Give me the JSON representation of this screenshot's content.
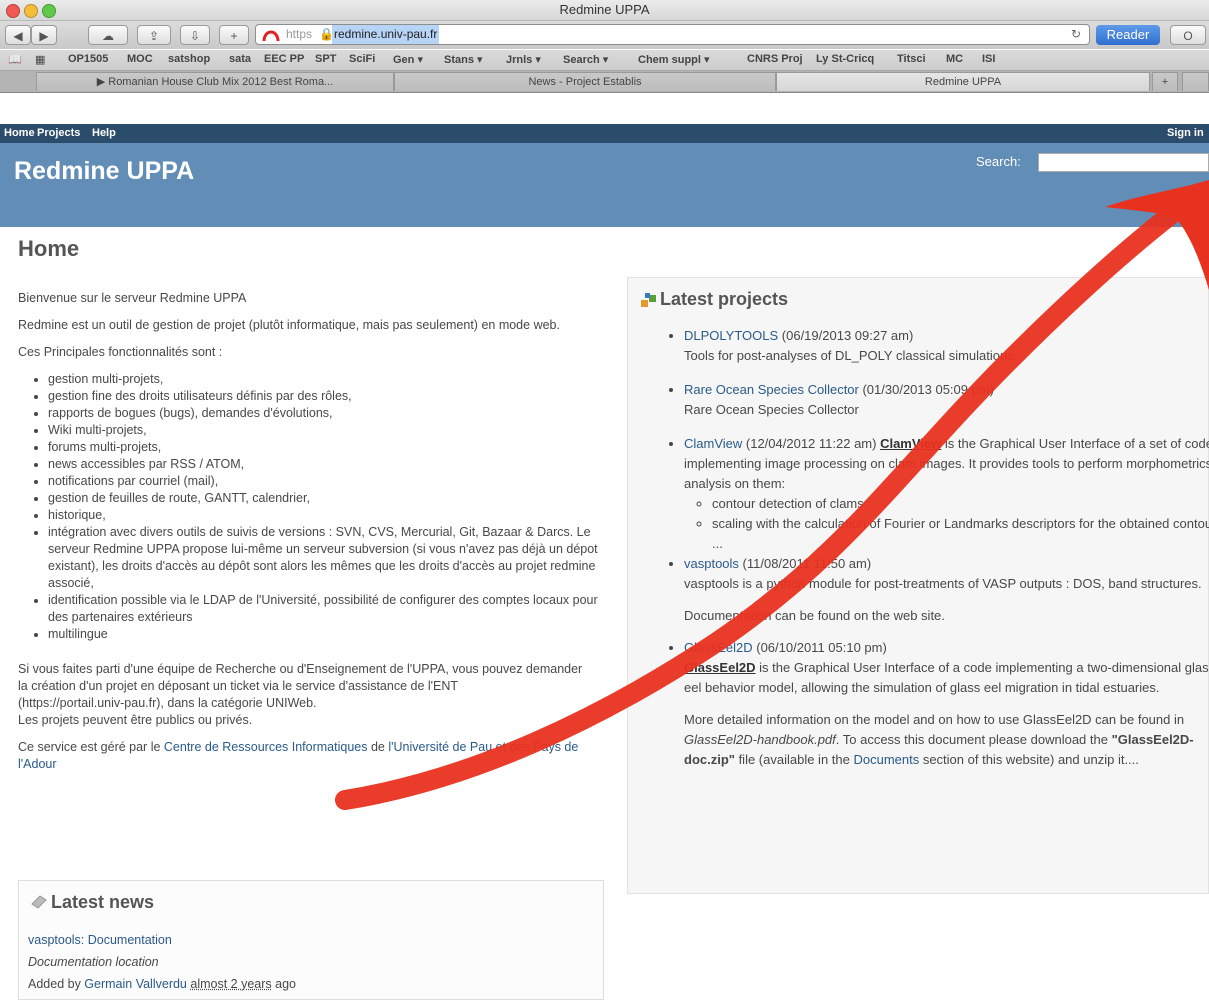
{
  "browser": {
    "window_title": "Redmine UPPA",
    "url_protocol": "https",
    "url_host": "redmine.univ-pau.fr",
    "reader_label": "Reader",
    "bookmarks": [
      "OP1505",
      "MOC",
      "satshop",
      "sata",
      "EEC PP",
      "SPT",
      "SciFi",
      "Gen ▾",
      "Stans ▾",
      "Jrnls ▾",
      "Search ▾",
      "Chem suppl ▾",
      "CNRS Proj",
      "Ly St-Cricq",
      "Titsci",
      "MC",
      "ISI"
    ],
    "tabs": [
      "▶ Romanian House Club Mix 2012 Best Roma...",
      "News - Project Establis",
      "Redmine UPPA"
    ],
    "new_tab_label": "+"
  },
  "topmenu": {
    "home": "Home",
    "projects": "Projects",
    "help": "Help",
    "sign_in": "Sign in"
  },
  "header": {
    "title": "Redmine UPPA",
    "search_label": "Search:"
  },
  "main": {
    "heading": "Home",
    "welcome": "Bienvenue sur le serveur Redmine UPPA",
    "intro": "Redmine est un outil de gestion de projet (plutôt informatique, mais pas seulement) en mode web.",
    "features_title": "Ces Principales fonctionnalités sont :",
    "features": [
      "gestion multi-projets,",
      "gestion fine des droits utilisateurs définis par des rôles,",
      "rapports de bogues (bugs), demandes d'évolutions,",
      "Wiki multi-projets,",
      "forums multi-projets,",
      "news accessibles par RSS / ATOM,",
      "notifications par courriel (mail),",
      "gestion de feuilles de route, GANTT, calendrier,",
      "historique,",
      "intégration avec divers outils de suivis de versions : SVN, CVS, Mercurial, Git, Bazaar & Darcs. Le serveur Redmine UPPA propose lui-même un serveur subversion (si vous n'avez pas déjà un dépot existant), les droits d'accès au dépôt sont alors les mêmes que les droits d'accès au projet redmine associé,",
      "identification possible via le LDAP de l'Université, possibilité de configurer des comptes locaux pour des partenaires extérieurs",
      "multilingue"
    ],
    "request_1": "Si vous faites parti d'une équipe de Recherche ou d'Enseignement de l'UPPA, vous pouvez demander",
    "request_2": "la création d'un projet en déposant un ticket via le service d'assistance de l'ENT",
    "request_3": "(https://portail.univ-pau.fr), dans la catégorie UNIWeb.",
    "request_4": "Les projets peuvent être publics ou privés.",
    "managed_prefix": "Ce service est géré par le ",
    "managed_link1": "Centre de Ressources Informatiques",
    "managed_mid": " de ",
    "managed_link2": "l'Université de Pau et des Pays de l'Adour"
  },
  "news": {
    "heading": "Latest news",
    "item_title": "vasptools: Documentation",
    "item_desc": "Documentation location",
    "added_by": "Added by ",
    "author": "Germain Vallverdu",
    "time": "almost 2 years",
    "ago": " ago"
  },
  "projects": {
    "heading": "Latest projects",
    "items": [
      {
        "name": "DLPOLYTOOLS",
        "date": " (06/19/2013 09:27 am)",
        "desc": "Tools for post-analyses of DL_POLY classical simulations."
      },
      {
        "name": "Rare Ocean Species Collector",
        "date": " (01/30/2013 05:09 pm)",
        "desc": "Rare Ocean Species Collector"
      },
      {
        "name": "ClamView",
        "date": " (12/04/2012 11:22 am) ",
        "bold": "ClamView",
        "desc": " is the Graphical User Interface of a set of codes implementing image processing on clam images. It provides tools to perform morphometrics analysis on them:",
        "sub": [
          "contour detection of clams;",
          "scaling with the calculation of Fourier or Landmarks descriptors for the obtained contours; ..."
        ]
      },
      {
        "name": "vasptools",
        "date": " (11/08/2011 11:50 am)",
        "desc": "vasptools is a python module for post-treatments of VASP outputs : DOS, band structures.",
        "desc2": "Documentation can be found on the web site."
      },
      {
        "name": "GlassEel2D",
        "date": " (06/10/2011 05:10 pm)",
        "bold": "GlassEel2D",
        "desc": " is the Graphical User Interface of a code implementing a two-dimensional glass eel behavior model, allowing the simulation of glass eel migration in tidal estuaries.",
        "more_1": "More detailed information on the model and on how to use GlassEel2D can be found in ",
        "more_file": "GlassEel2D-handbook.pdf",
        "more_2": ". To access this document please download the ",
        "more_zip": "\"GlassEel2D-doc.zip\"",
        "more_3": " file (available in the ",
        "more_link": "Documents",
        "more_4": " section of this website) and unzip it...."
      }
    ]
  },
  "colors": {
    "topmenu": "#2c4c6c",
    "header": "#628db6",
    "link": "#2a5a8a",
    "annotation_arrow": "#e8321f"
  }
}
